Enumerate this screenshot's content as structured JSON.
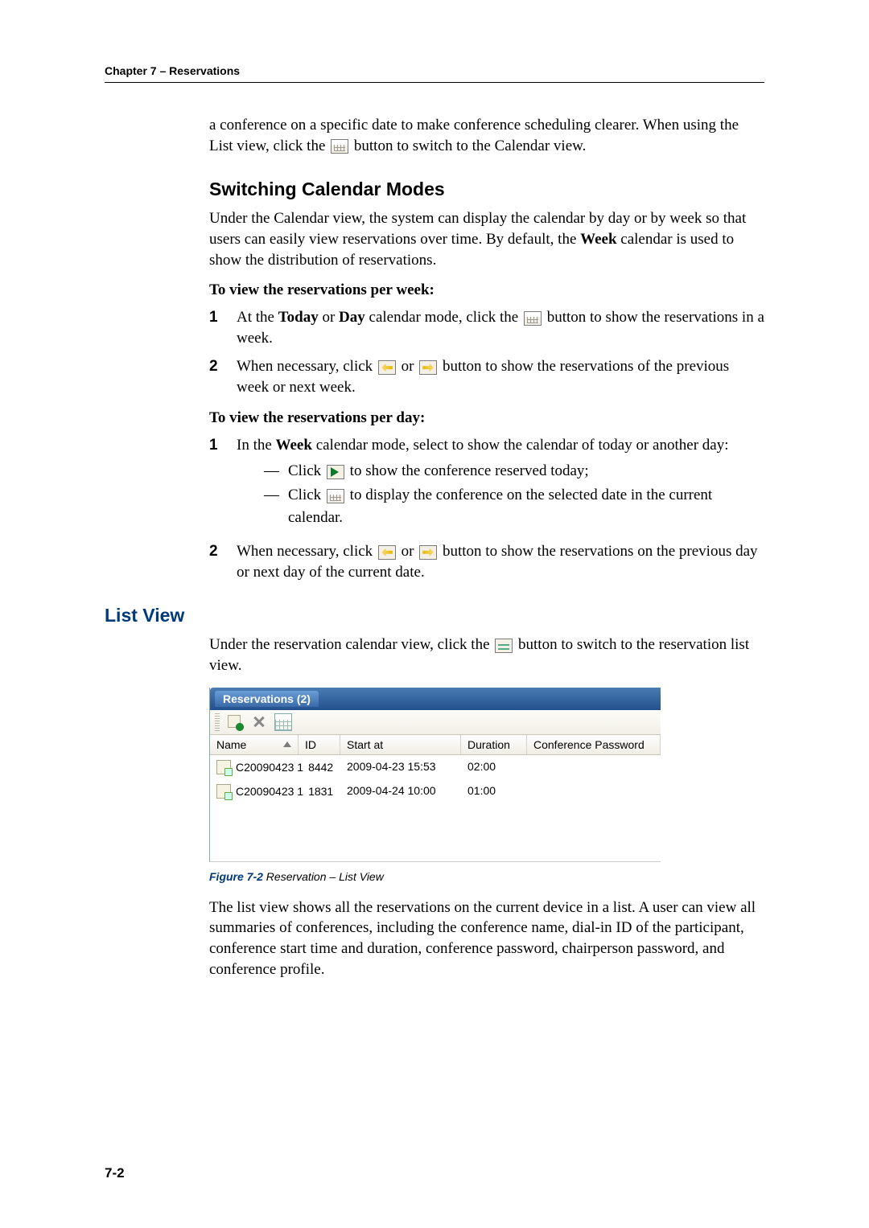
{
  "header": {
    "chapter_line": "Chapter 7 – Reservations"
  },
  "intro": {
    "line1": "a conference on a specific date to make conference scheduling clearer. When using the List view, click the ",
    "line2": " button to switch to the Calendar view."
  },
  "switching": {
    "title": "Switching Calendar Modes",
    "p1a": "Under the Calendar view, the system can display the calendar by day or by week so that users can easily view reservations over time. By default, the ",
    "p1b_bold": "Week",
    "p1c": " calendar is used to show the distribution of reservations.",
    "per_week_heading": "To view the reservations per week:",
    "s1_a": "At the ",
    "s1_today": "Today",
    "s1_or": " or ",
    "s1_day": "Day",
    "s1_b": " calendar mode, click the ",
    "s1_c": " button to show the reservations in a week.",
    "s2_a": "When necessary, click ",
    "s2_or": " or ",
    "s2_b": " button to show the reservations of the previous week or next week.",
    "per_day_heading": "To view the reservations per day:",
    "d1_a": "In the ",
    "d1_week": "Week",
    "d1_b": " calendar mode, select to show the calendar of today or another day:",
    "d1_i1_a": "Click ",
    "d1_i1_b": " to show the conference reserved today;",
    "d1_i2_a": "Click ",
    "d1_i2_b": " to display the conference on the selected date in the current calendar.",
    "d2_a": "When necessary, click ",
    "d2_or": " or ",
    "d2_b": " button to show the reservations on the previous day or next day of the current date."
  },
  "listview": {
    "title": "List View",
    "p1a": "Under the reservation calendar view, click the ",
    "p1b": " button to switch to the reservation list view.",
    "p2": "The list view shows all the reservations on the current device in a list. A user can view all summaries of conferences, including the conference name, dial-in ID of the participant, conference start time and duration, conference password, chairperson password, and conference profile."
  },
  "figure": {
    "titlebar": "Reservations (2)",
    "columns": {
      "name": "Name",
      "id": "ID",
      "start": "Start at",
      "duration": "Duration",
      "pw": "Conference Password"
    },
    "rows": [
      {
        "name": "C20090423 1",
        "id": "8442",
        "start": "2009-04-23 15:53",
        "duration": "02:00"
      },
      {
        "name": "C20090423 1",
        "id": "1831",
        "start": "2009-04-24 10:00",
        "duration": "01:00"
      }
    ],
    "caption_lead": "Figure 7-2",
    "caption_rest": " Reservation – List View"
  },
  "page_number": "7-2",
  "step_nums": {
    "one": "1",
    "two": "2"
  },
  "dash": "—"
}
